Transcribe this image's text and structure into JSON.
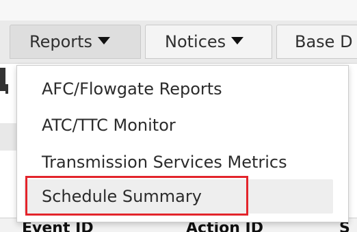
{
  "nav": {
    "tabs": [
      {
        "label": "Reports",
        "has_dropdown": true,
        "state": "open"
      },
      {
        "label": "Notices",
        "has_dropdown": true,
        "state": "closed"
      },
      {
        "label": "Base D",
        "has_dropdown": false,
        "state": "closed"
      }
    ],
    "caret_icon": "caret-down-icon"
  },
  "dropdown": {
    "items": [
      {
        "label": "AFC/Flowgate Reports"
      },
      {
        "label": "ATC/TTC Monitor"
      },
      {
        "label": "Transmission Services Metrics"
      },
      {
        "label": "Schedule Summary",
        "hovered": true
      }
    ]
  },
  "background_table": {
    "headers": [
      "Event ID",
      "Action ID",
      "S"
    ]
  },
  "colors": {
    "highlight_border": "#e3242b",
    "nav_background": "#eaeaea",
    "active_tab": "#dedede",
    "hover_item": "#eeeeee"
  }
}
